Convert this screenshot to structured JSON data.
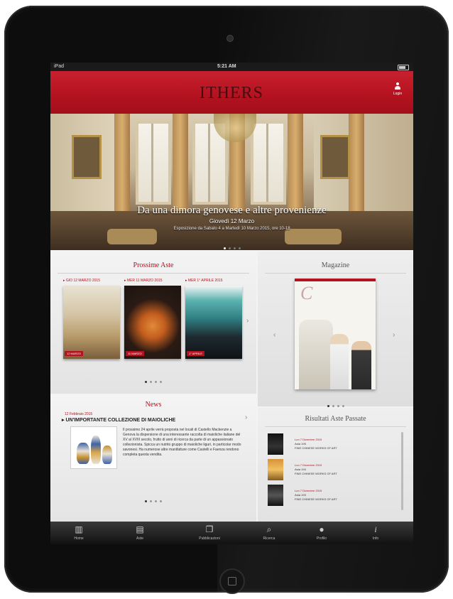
{
  "statusbar": {
    "carrier": "iPad",
    "time": "5:21 AM"
  },
  "header": {
    "logo": "ITHERS",
    "login_label": "Login"
  },
  "hero": {
    "title": "Da una dimora genovese e altre provenienze",
    "date": "Giovedì 12 Marzo",
    "info": "Esposizione da Sabato 4 a Martedì 10 Marzo 2015, ore 10-18"
  },
  "prossime": {
    "title": "Prossime Aste",
    "auctions": [
      {
        "label": "▸ GIO 12 MARZO 2015",
        "badge": "12 MARZO"
      },
      {
        "label": "▸ MER 11 MARZO 2015",
        "badge": "11 MARZO"
      },
      {
        "label": "▸ MER 1° APRILE 2015",
        "badge": "1° APRILE"
      }
    ]
  },
  "magazine": {
    "title": "Magazine"
  },
  "news": {
    "title": "News",
    "date": "12 Febbraio 2015",
    "headline": "▸ UN'IMPORTANTE COLLEZIONE DI MAIOLICHE",
    "body": "Il prossimo 24 aprile verrà proposta nel locali di Castello Mackenzie a Genova la dispersione di una interessante raccolta di maioliche italiane del XV al XVIII secolo, frutto di anni di ricerca da parte di un appassionato collezionista. Spicca un nutrito gruppo di maioliche liguri, in particolar modo savonesi. Ha numerose altre manifatture come Castelli e Faenza rendono completa questa vendita."
  },
  "risultati": {
    "title": "Risultati Aste Passate",
    "items": [
      {
        "date": "Lun 7 Dicembre 2015",
        "id": "Asta 195",
        "title": "FINE CHINESE WORKS OF ART"
      },
      {
        "date": "Lun 7 Dicembre 2015",
        "id": "Asta 194",
        "title": "FINE CHINESE WORKS OF ART"
      },
      {
        "date": "Lun 7 Dicembre 2015",
        "id": "Asta 193",
        "title": "FINE CHINESE WORKS OF ART"
      }
    ]
  },
  "tabs": [
    {
      "label": "Home",
      "icon": "building-icon"
    },
    {
      "label": "Aste",
      "icon": "calendar-icon"
    },
    {
      "label": "Pubblicazioni",
      "icon": "book-icon"
    },
    {
      "label": "Ricerca",
      "icon": "search-icon"
    },
    {
      "label": "Profilo",
      "icon": "person-icon"
    },
    {
      "label": "Info",
      "icon": "info-icon"
    }
  ],
  "colors": {
    "brand_red": "#b3121f",
    "tabbar": "#1a1a1a"
  }
}
